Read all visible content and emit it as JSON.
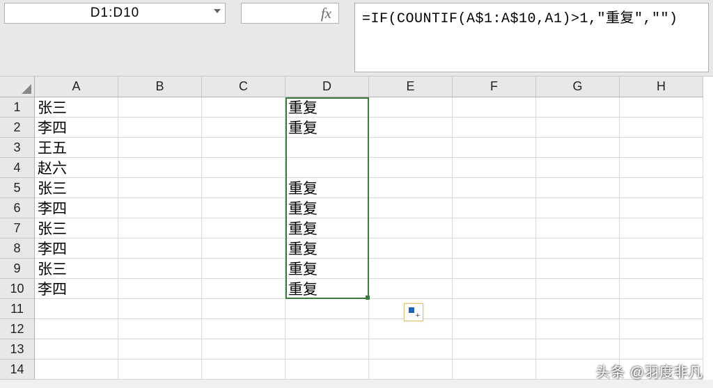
{
  "name_box": "D1:D10",
  "fx_label": "fx",
  "formula": "=IF(COUNTIF(A$1:A$10,A1)>1,\"重复\",\"\")",
  "columns": [
    "A",
    "B",
    "C",
    "D",
    "E",
    "F",
    "G",
    "H"
  ],
  "rows_count": 14,
  "chart_data": {
    "type": "table",
    "columns": [
      "A",
      "B",
      "C",
      "D"
    ],
    "rows": [
      {
        "A": "张三",
        "B": "",
        "C": "",
        "D": "重复"
      },
      {
        "A": "李四",
        "B": "",
        "C": "",
        "D": "重复"
      },
      {
        "A": "王五",
        "B": "",
        "C": "",
        "D": ""
      },
      {
        "A": "赵六",
        "B": "",
        "C": "",
        "D": ""
      },
      {
        "A": "张三",
        "B": "",
        "C": "",
        "D": "重复"
      },
      {
        "A": "李四",
        "B": "",
        "C": "",
        "D": "重复"
      },
      {
        "A": "张三",
        "B": "",
        "C": "",
        "D": "重复"
      },
      {
        "A": "李四",
        "B": "",
        "C": "",
        "D": "重复"
      },
      {
        "A": "张三",
        "B": "",
        "C": "",
        "D": "重复"
      },
      {
        "A": "李四",
        "B": "",
        "C": "",
        "D": "重复"
      },
      {
        "A": "",
        "B": "",
        "C": "",
        "D": ""
      },
      {
        "A": "",
        "B": "",
        "C": "",
        "D": ""
      },
      {
        "A": "",
        "B": "",
        "C": "",
        "D": ""
      },
      {
        "A": "",
        "B": "",
        "C": "",
        "D": ""
      }
    ]
  },
  "selection": {
    "col": "D",
    "start": 1,
    "end": 10
  },
  "watermark": "头条 @羽度非凡"
}
